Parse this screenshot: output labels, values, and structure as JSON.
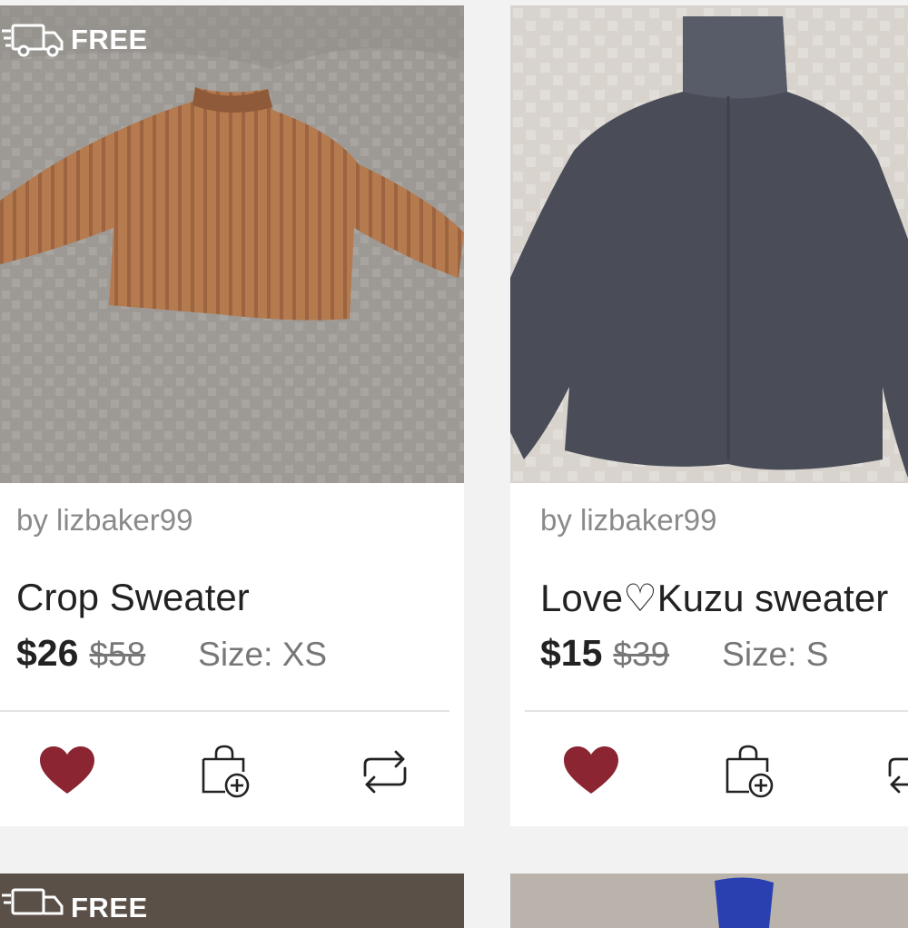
{
  "badge": {
    "free_label": "FREE"
  },
  "listings": [
    {
      "seller": "by lizbaker99",
      "title": "Crop Sweater",
      "price": "$26",
      "original_price": "$58",
      "size": "Size: XS",
      "liked": true
    },
    {
      "seller": "by lizbaker99",
      "title": "Love♡Kuzu sweater",
      "price": "$15",
      "original_price": "$39",
      "size": "Size: S",
      "liked": true
    }
  ],
  "colors": {
    "heart": "#8b2532",
    "text_primary": "#222222",
    "text_secondary": "#8a8a8a"
  },
  "icons": [
    "truck-icon",
    "heart-icon",
    "shopping-bag-add-icon",
    "share-repost-icon"
  ]
}
